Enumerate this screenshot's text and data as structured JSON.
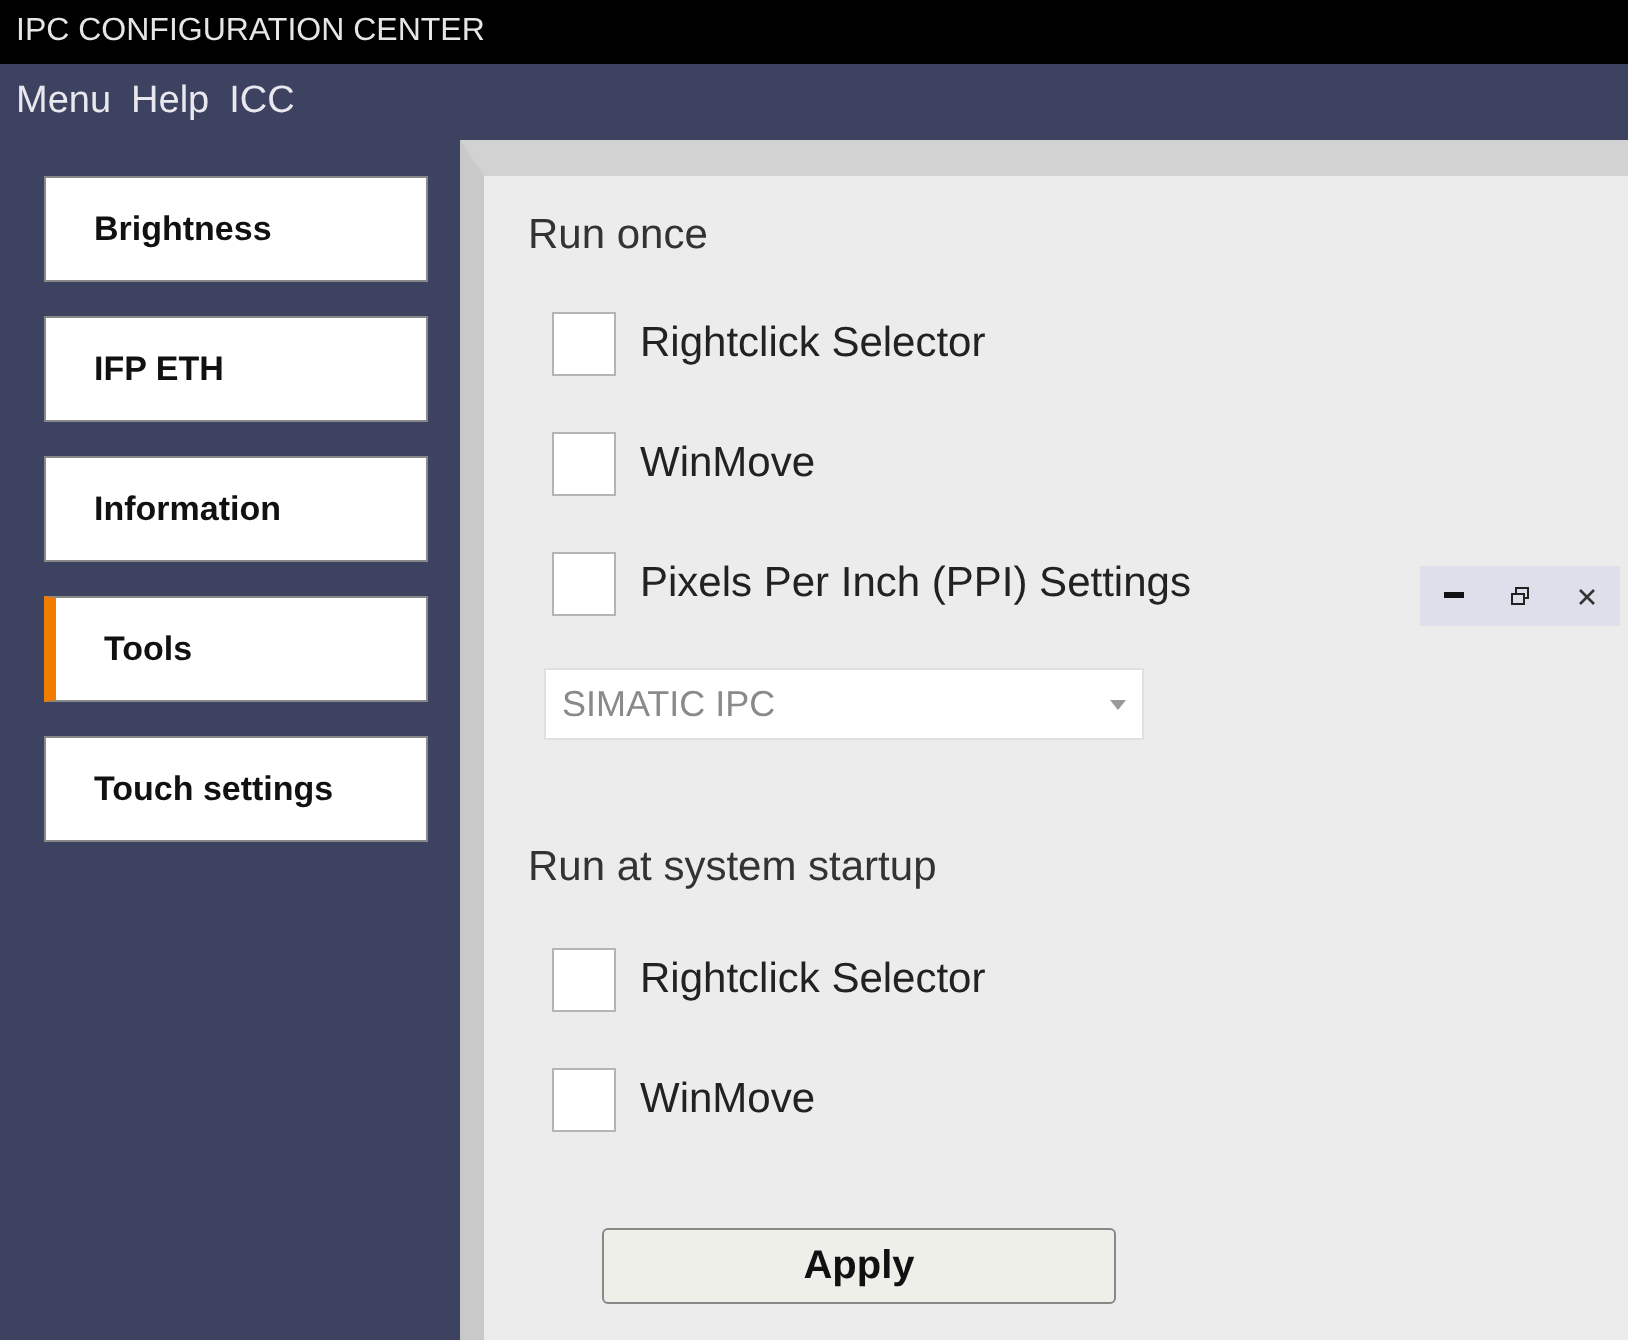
{
  "window": {
    "title": "IPC CONFIGURATION CENTER"
  },
  "menu": [
    "Menu",
    "Help",
    "ICC"
  ],
  "sidebar": {
    "items": [
      {
        "label": "Brightness",
        "selected": false
      },
      {
        "label": "IFP ETH",
        "selected": false
      },
      {
        "label": "Information",
        "selected": false
      },
      {
        "label": "Tools",
        "selected": true
      },
      {
        "label": "Touch settings",
        "selected": false
      }
    ]
  },
  "run_once": {
    "heading": "Run once",
    "options": [
      {
        "label": "Rightclick Selector",
        "checked": false
      },
      {
        "label": "WinMove",
        "checked": false
      },
      {
        "label": "Pixels Per Inch (PPI) Settings",
        "checked": false
      }
    ],
    "dropdown": {
      "value": "SIMATIC IPC",
      "disabled": true
    }
  },
  "run_at_startup": {
    "heading": "Run at system startup",
    "options": [
      {
        "label": "Rightclick Selector",
        "checked": false
      },
      {
        "label": "WinMove",
        "checked": false
      }
    ]
  },
  "apply_button": "Apply"
}
